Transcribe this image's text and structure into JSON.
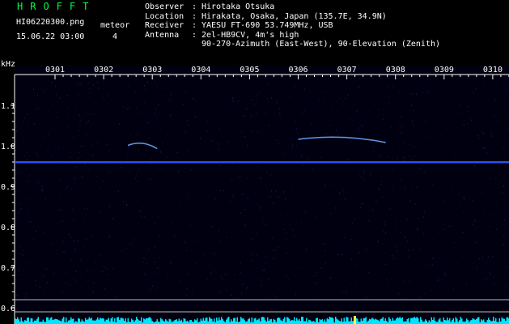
{
  "header": {
    "logo": "HROFFT",
    "filename": "HI06220300.png",
    "meteor_label": "meteor",
    "date": "15.06.22 03:00",
    "meteor_count": "4"
  },
  "observer_info": [
    {
      "key": "Observer",
      "value": "Hirotaka Otsuka"
    },
    {
      "key": "Location",
      "value": "Hirakata, Osaka, Japan (135.7E, 34.9N)"
    },
    {
      "key": "Receiver",
      "value": "YAESU FT-690 53.749MHz, USB"
    },
    {
      "key": "Antenna",
      "value": "2el-HB9CV, 4m's high"
    },
    {
      "key": "",
      "value": "90-270-Azimuth (East-West), 90-Elevation (Zenith)"
    }
  ],
  "chart_data": {
    "type": "heatmap",
    "ylabel": "kHz",
    "x_ticks": [
      "0301",
      "0302",
      "0303",
      "0304",
      "0305",
      "0306",
      "0307",
      "0308",
      "0309",
      "0310"
    ],
    "y_ticks": [
      "1.1",
      "1.0",
      "0.9",
      "0.8",
      "0.7",
      "0.6"
    ],
    "ylim": [
      0.58,
      1.14
    ],
    "carrier_frequency_khz": 0.96,
    "meteor_traces": [
      {
        "start_time": "0302.5",
        "end_time": "0303.1",
        "freq_khz": 1.005
      },
      {
        "start_time": "0306.0",
        "end_time": "0307.8",
        "freq_khz": 1.02
      }
    ],
    "colors": {
      "background": "#000010",
      "carrier": "#2a4cff",
      "meteor": "#6fa8ff",
      "noise": "#00e5ff",
      "logo": "#00ff40"
    }
  }
}
